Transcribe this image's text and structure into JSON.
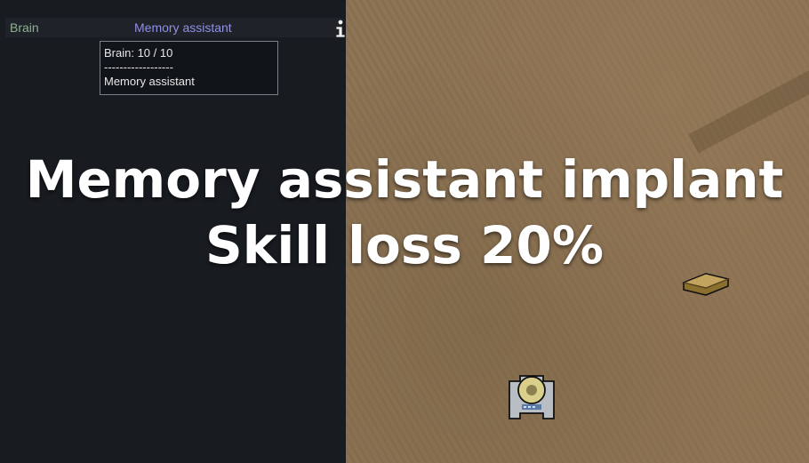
{
  "health_panel": {
    "row": {
      "body_part": "Brain",
      "condition": "Memory assistant"
    },
    "tooltip": {
      "line1": "Brain:  10 / 10",
      "separator": "------------------",
      "line3": "Memory assistant"
    }
  },
  "overlay": {
    "title": "Memory assistant implant",
    "subtitle": "Skill loss 20%"
  },
  "icons": {
    "info": "info-icon",
    "bedroll": "bedroll-icon",
    "pawn": "pawn-icon"
  },
  "colors": {
    "panel_bg": "#181b20",
    "body_part_text": "#8fb08f",
    "condition_text": "#8f8fe6",
    "map_ground": "#8b7152",
    "overlay_text": "#ffffff"
  }
}
